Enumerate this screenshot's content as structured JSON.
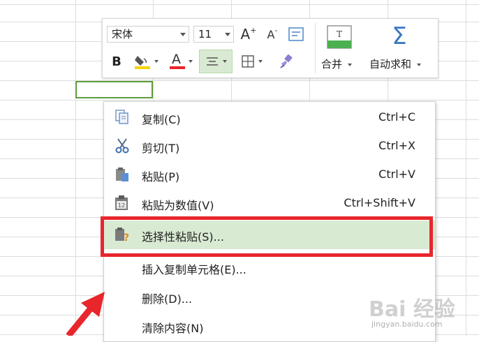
{
  "toolbar": {
    "font_name": "宋体",
    "font_size": "11",
    "increase_font_label": "A",
    "decrease_font_label": "A",
    "bold_label": "B",
    "font_color_label": "A",
    "merge_label": "合并",
    "autosum_label": "自动求和",
    "font_color": "#e8262b",
    "fill_color": "#f5d400"
  },
  "context_menu": {
    "items": [
      {
        "label": "复制(C)",
        "shortcut": "Ctrl+C",
        "icon": "copy-icon"
      },
      {
        "label": "剪切(T)",
        "shortcut": "Ctrl+X",
        "icon": "scissors-icon"
      },
      {
        "label": "粘贴(P)",
        "shortcut": "Ctrl+V",
        "icon": "paste-icon"
      },
      {
        "label": "粘贴为数值(V)",
        "shortcut": "Ctrl+Shift+V",
        "icon": "paste-values-icon"
      },
      {
        "label": "选择性粘贴(S)...",
        "shortcut": "",
        "icon": "paste-special-icon"
      },
      {
        "label": "插入复制单元格(E)...",
        "shortcut": "",
        "icon": ""
      },
      {
        "label": "删除(D)...",
        "shortcut": "",
        "icon": ""
      },
      {
        "label": "清除内容(N)",
        "shortcut": "",
        "icon": ""
      }
    ],
    "paste_values_badge": "12",
    "highlight_color": "#d9ead3",
    "annotation_color": "#e8262b"
  },
  "watermark": {
    "text": "Bai 经验",
    "sub": "jingyan.baidu.com"
  }
}
